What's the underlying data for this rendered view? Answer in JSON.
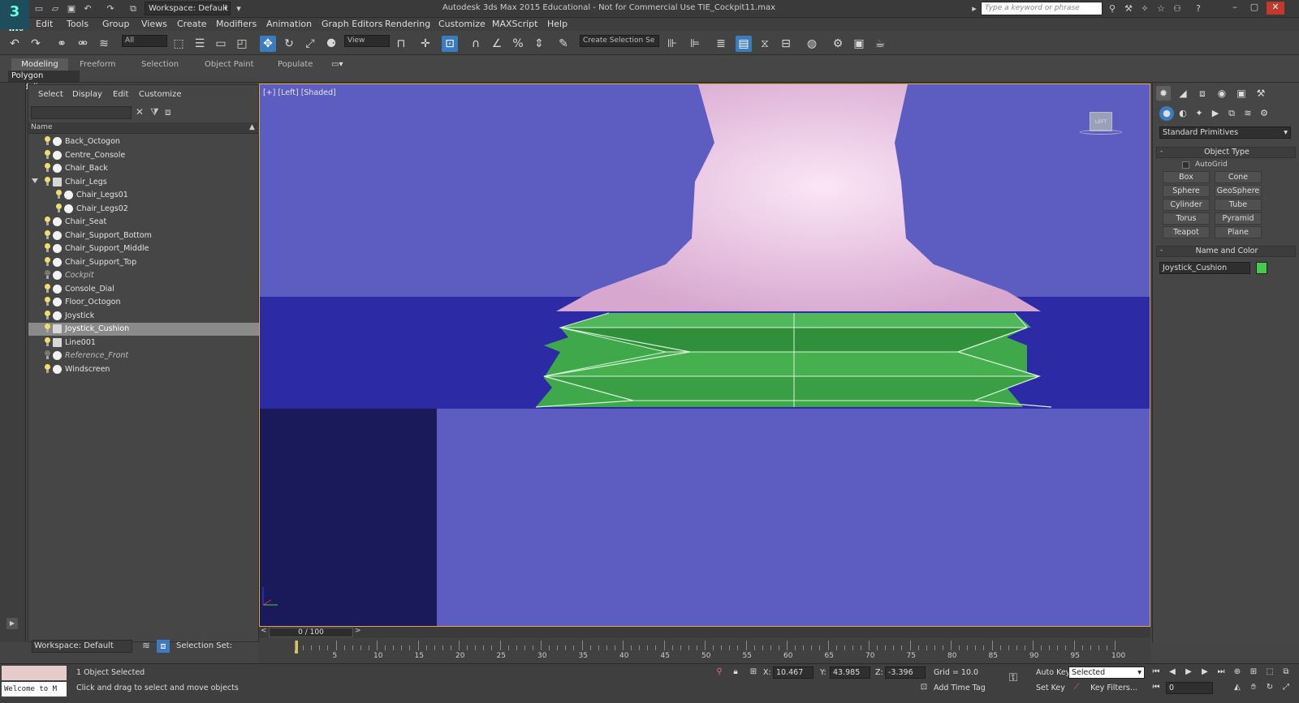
{
  "app": {
    "logo_text": "3",
    "logo_sub": "MAX",
    "workspace": "Workspace: Default",
    "title": "Autodesk 3ds Max 2015  Educational - Not for Commercial Use    TIE_Cockpit11.max",
    "search_placeholder": "Type a keyword or phrase"
  },
  "menu": [
    "Edit",
    "Tools",
    "Group",
    "Views",
    "Create",
    "Modifiers",
    "Animation",
    "Graph Editors",
    "Rendering",
    "Customize",
    "MAXScript",
    "Help"
  ],
  "toolbar": {
    "selection_filter": "All",
    "ref_coord": "View",
    "selection_set": "Create Selection Se"
  },
  "ribbon": {
    "tabs": [
      "Modeling",
      "Freeform",
      "Selection",
      "Object Paint",
      "Populate"
    ],
    "sub_label": "Polygon Modeling"
  },
  "explorer": {
    "menu": [
      "Select",
      "Display",
      "Edit",
      "Customize"
    ],
    "column_name": "Name",
    "objects": [
      {
        "name": "Back_Octogon",
        "level": 0,
        "type": "geo",
        "frozen": false,
        "selected": false
      },
      {
        "name": "Centre_Console",
        "level": 0,
        "type": "geo",
        "frozen": false,
        "selected": false
      },
      {
        "name": "Chair_Back",
        "level": 0,
        "type": "geo",
        "frozen": false,
        "selected": false
      },
      {
        "name": "Chair_Legs",
        "level": 0,
        "type": "group",
        "frozen": false,
        "selected": false,
        "expanded": true
      },
      {
        "name": "Chair_Legs01",
        "level": 1,
        "type": "geo",
        "frozen": false,
        "selected": false
      },
      {
        "name": "Chair_Legs02",
        "level": 1,
        "type": "geo",
        "frozen": false,
        "selected": false
      },
      {
        "name": "Chair_Seat",
        "level": 0,
        "type": "geo",
        "frozen": false,
        "selected": false
      },
      {
        "name": "Chair_Support_Bottom",
        "level": 0,
        "type": "geo",
        "frozen": false,
        "selected": false
      },
      {
        "name": "Chair_Support_Middle",
        "level": 0,
        "type": "geo",
        "frozen": false,
        "selected": false
      },
      {
        "name": "Chair_Support_Top",
        "level": 0,
        "type": "geo",
        "frozen": false,
        "selected": false
      },
      {
        "name": "Cockpit",
        "level": 0,
        "type": "geo",
        "frozen": true,
        "selected": false
      },
      {
        "name": "Console_Dial",
        "level": 0,
        "type": "geo",
        "frozen": false,
        "selected": false
      },
      {
        "name": "Floor_Octogon",
        "level": 0,
        "type": "geo",
        "frozen": false,
        "selected": false
      },
      {
        "name": "Joystick",
        "level": 0,
        "type": "geo",
        "frozen": false,
        "selected": false
      },
      {
        "name": "Joystick_Cushion",
        "level": 0,
        "type": "group",
        "frozen": false,
        "selected": true
      },
      {
        "name": "Line001",
        "level": 0,
        "type": "group",
        "frozen": false,
        "selected": false
      },
      {
        "name": "Reference_Front",
        "level": 0,
        "type": "geo",
        "frozen": true,
        "selected": false
      },
      {
        "name": "Windscreen",
        "level": 0,
        "type": "geo",
        "frozen": false,
        "selected": false
      }
    ],
    "footer_workspace": "Workspace: Default",
    "footer_selset": "Selection Set:"
  },
  "viewport": {
    "label": "[+] [Left] [Shaded]",
    "viewcube": "LEFT",
    "colors": {
      "background": "#5c5cc1",
      "band": "#2d2aa6",
      "dark": "#1a1a5a",
      "joystick": "#e6b8df",
      "cushion": "#3fa84a"
    }
  },
  "command_panel": {
    "category": "Standard Primitives",
    "object_type_title": "Object Type",
    "autogrid": "AutoGrid",
    "primitives": [
      "Box",
      "Cone",
      "Sphere",
      "GeoSphere",
      "Cylinder",
      "Tube",
      "Torus",
      "Pyramid",
      "Teapot",
      "Plane"
    ],
    "name_color_title": "Name and Color",
    "object_name": "Joystick_Cushion",
    "object_color": "#47c94e"
  },
  "timeline": {
    "frame_display": "0 / 100",
    "ticks": [
      "5",
      "10",
      "15",
      "20",
      "25",
      "30",
      "35",
      "40",
      "45",
      "50",
      "55",
      "60",
      "65",
      "70",
      "75",
      "80",
      "85",
      "90",
      "95",
      "100"
    ]
  },
  "status": {
    "maxscript": "Welcome to M",
    "selected_count": "1 Object Selected",
    "prompt": "Click and drag to select and move objects",
    "x_label": "X:",
    "x_value": "10.467",
    "y_label": "Y:",
    "y_value": "43.985",
    "z_label": "Z:",
    "z_value": "-3.396",
    "grid": "Grid = 10.0",
    "add_time_tag": "Add Time Tag",
    "auto_key": "Auto Key",
    "set_key": "Set Key",
    "key_mode": "Selected",
    "key_filters": "Key Filters...",
    "frame": "0"
  }
}
